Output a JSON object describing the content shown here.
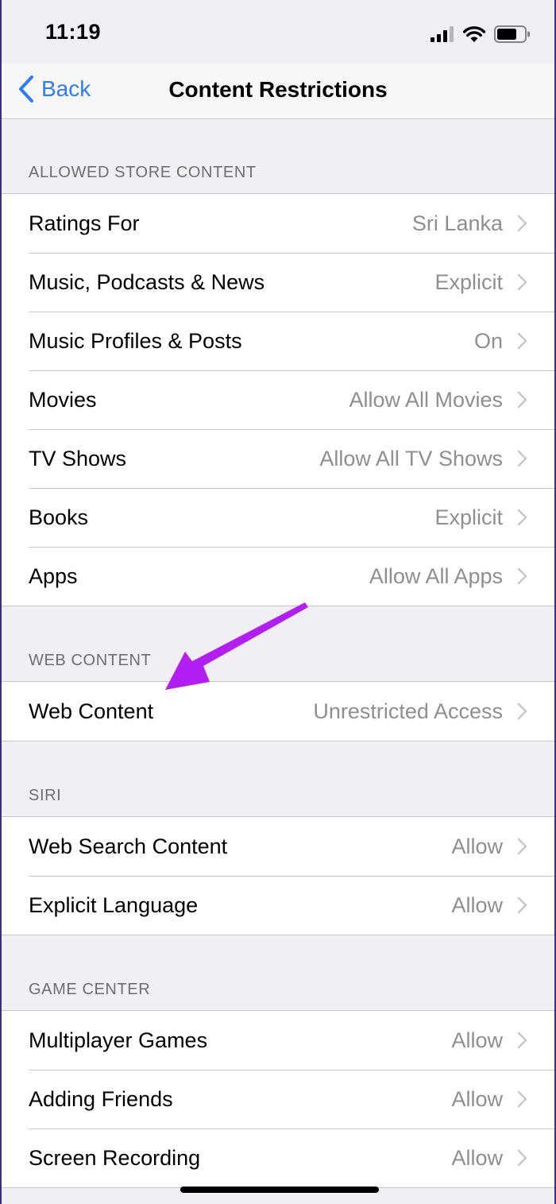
{
  "status_bar": {
    "time": "11:19",
    "icons": [
      "cellular-signal-icon",
      "wifi-icon",
      "battery-icon"
    ]
  },
  "nav": {
    "back_label": "Back",
    "title": "Content Restrictions",
    "accent_color": "#2f7cf6"
  },
  "sections": [
    {
      "header": "ALLOWED STORE CONTENT",
      "rows": [
        {
          "label": "Ratings For",
          "value": "Sri Lanka"
        },
        {
          "label": "Music, Podcasts & News",
          "value": "Explicit"
        },
        {
          "label": "Music Profiles & Posts",
          "value": "On"
        },
        {
          "label": "Movies",
          "value": "Allow All Movies"
        },
        {
          "label": "TV Shows",
          "value": "Allow All TV Shows"
        },
        {
          "label": "Books",
          "value": "Explicit"
        },
        {
          "label": "Apps",
          "value": "Allow All Apps"
        }
      ]
    },
    {
      "header": "WEB CONTENT",
      "rows": [
        {
          "label": "Web Content",
          "value": "Unrestricted Access"
        }
      ]
    },
    {
      "header": "SIRI",
      "rows": [
        {
          "label": "Web Search Content",
          "value": "Allow"
        },
        {
          "label": "Explicit Language",
          "value": "Allow"
        }
      ]
    },
    {
      "header": "GAME CENTER",
      "rows": [
        {
          "label": "Multiplayer Games",
          "value": "Allow"
        },
        {
          "label": "Adding Friends",
          "value": "Allow"
        },
        {
          "label": "Screen Recording",
          "value": "Allow"
        }
      ]
    }
  ],
  "annotation": {
    "icon": "annotation-arrow-icon",
    "color": "#b31ef2"
  }
}
